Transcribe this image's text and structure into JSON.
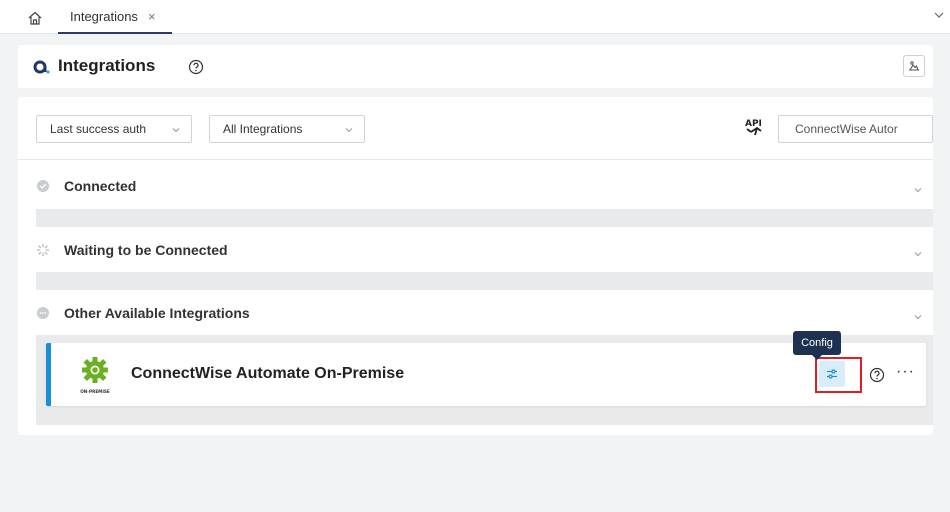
{
  "topbar": {
    "home_icon": "home-icon",
    "tab": {
      "label": "Integrations",
      "close": "×"
    }
  },
  "header": {
    "logo_icon": "brand-logo-icon",
    "title": "Integrations",
    "export_icon": "image-export-icon"
  },
  "filters": {
    "sort_select": {
      "value": "Last success auth"
    },
    "type_select": {
      "value": "All Integrations"
    },
    "api_icon": "api-icon",
    "search": {
      "value": "ConnectWise Autor"
    }
  },
  "sections": [
    {
      "title": "Connected",
      "icon": "check-circle-icon"
    },
    {
      "title": "Waiting to be Connected",
      "icon": "loading-spinner-icon"
    },
    {
      "title": "Other Available Integrations",
      "icon": "more-circle-icon"
    }
  ],
  "integration": {
    "name": "ConnectWise Automate On-Premise",
    "logo_text": "ON-PREMISE",
    "tooltip": "Config",
    "more": "···"
  },
  "colors": {
    "accent": "#1a8fd6",
    "brand_green": "#6ab023",
    "tooltip_bg": "#1e3150",
    "highlight": "#e02020"
  }
}
